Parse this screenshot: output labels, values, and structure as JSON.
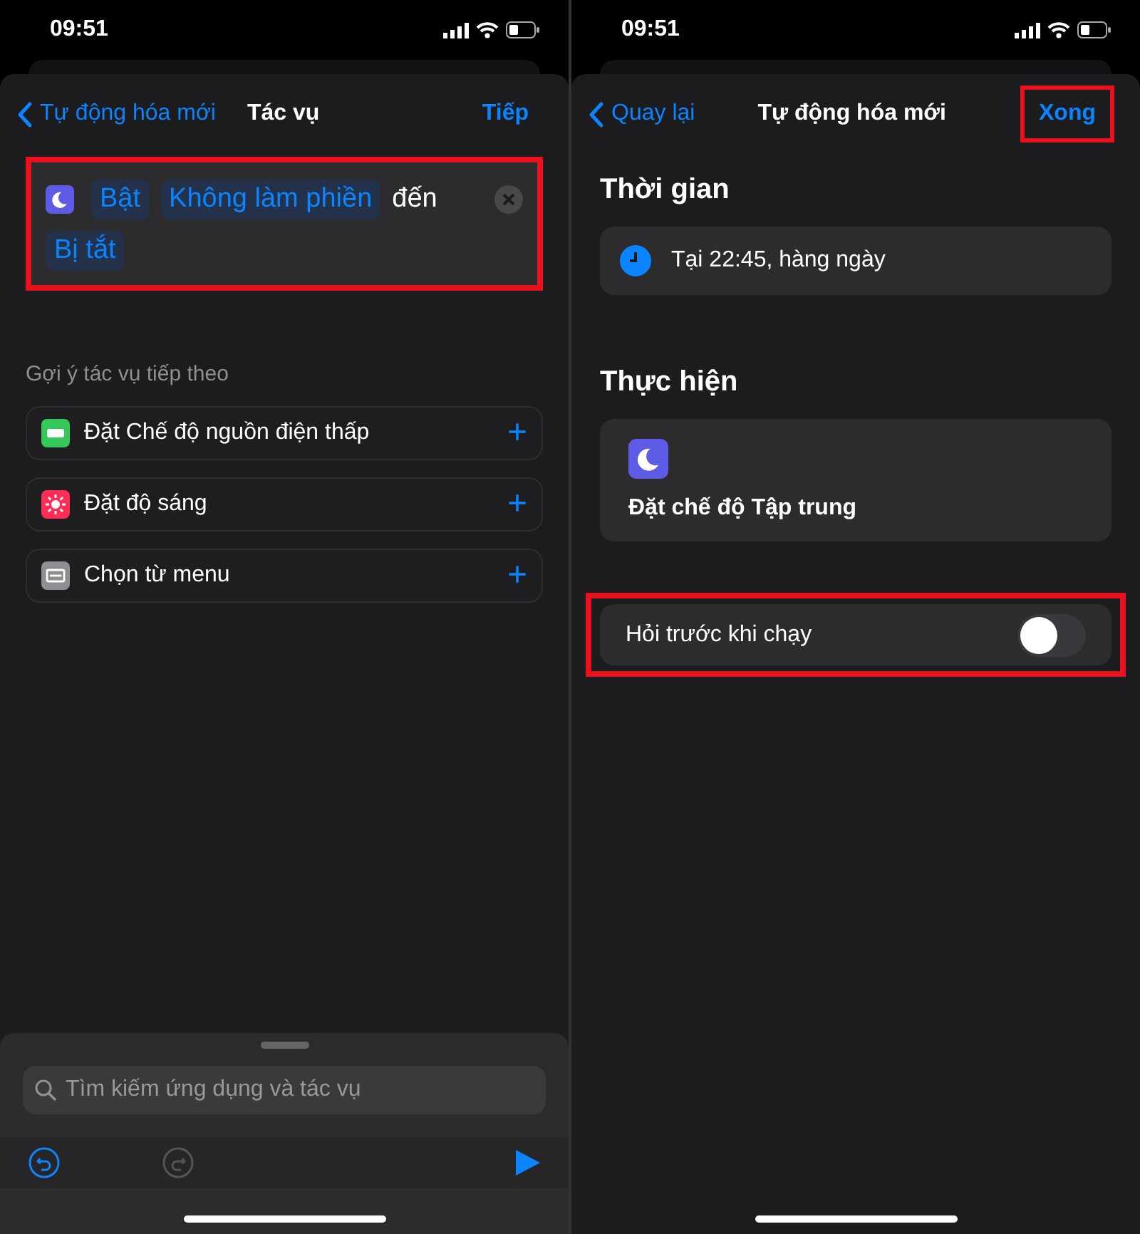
{
  "left": {
    "status_bar": {
      "time": "09:51"
    },
    "nav": {
      "back": "Tự động hóa mới",
      "title": "Tác vụ",
      "action": "Tiếp"
    },
    "action_card": {
      "highlighted": true,
      "tokens": [
        {
          "text": "Bật",
          "kind": "variable"
        },
        {
          "text": "Không làm phiền",
          "kind": "variable"
        },
        {
          "text": "đến",
          "kind": "plain"
        },
        {
          "text": "Bị tắt",
          "kind": "variable"
        }
      ]
    },
    "suggestions": {
      "heading": "Gợi ý tác vụ tiếp theo",
      "items": [
        {
          "label": "Đặt Chế độ nguồn điện thấp",
          "kind": "battery",
          "color": "#34c759",
          "add": "+"
        },
        {
          "label": "Đặt độ sáng",
          "kind": "brightness",
          "color": "#ff2d55",
          "add": "+"
        },
        {
          "label": "Chọn từ menu",
          "kind": "menu",
          "color": "#8e8e93",
          "add": "+"
        }
      ]
    },
    "search": {
      "placeholder": "Tìm kiếm ứng dụng và tác vụ"
    },
    "toolbar": {
      "undo_enabled": true,
      "redo_enabled": false
    }
  },
  "right": {
    "status_bar": {
      "time": "09:51"
    },
    "nav": {
      "back": "Quay lại",
      "title": "Tự động hóa mới",
      "action": "Xong",
      "action_highlighted": true
    },
    "sections": [
      {
        "heading": "Thời gian",
        "kind": "time",
        "text": "Tại 22:45, hàng ngày"
      },
      {
        "heading": "Thực hiện",
        "kind": "action",
        "text": "Đặt chế độ Tập trung"
      }
    ],
    "ask_before_running": {
      "label": "Hỏi trước khi chạy",
      "on": false,
      "highlighted": true
    }
  }
}
